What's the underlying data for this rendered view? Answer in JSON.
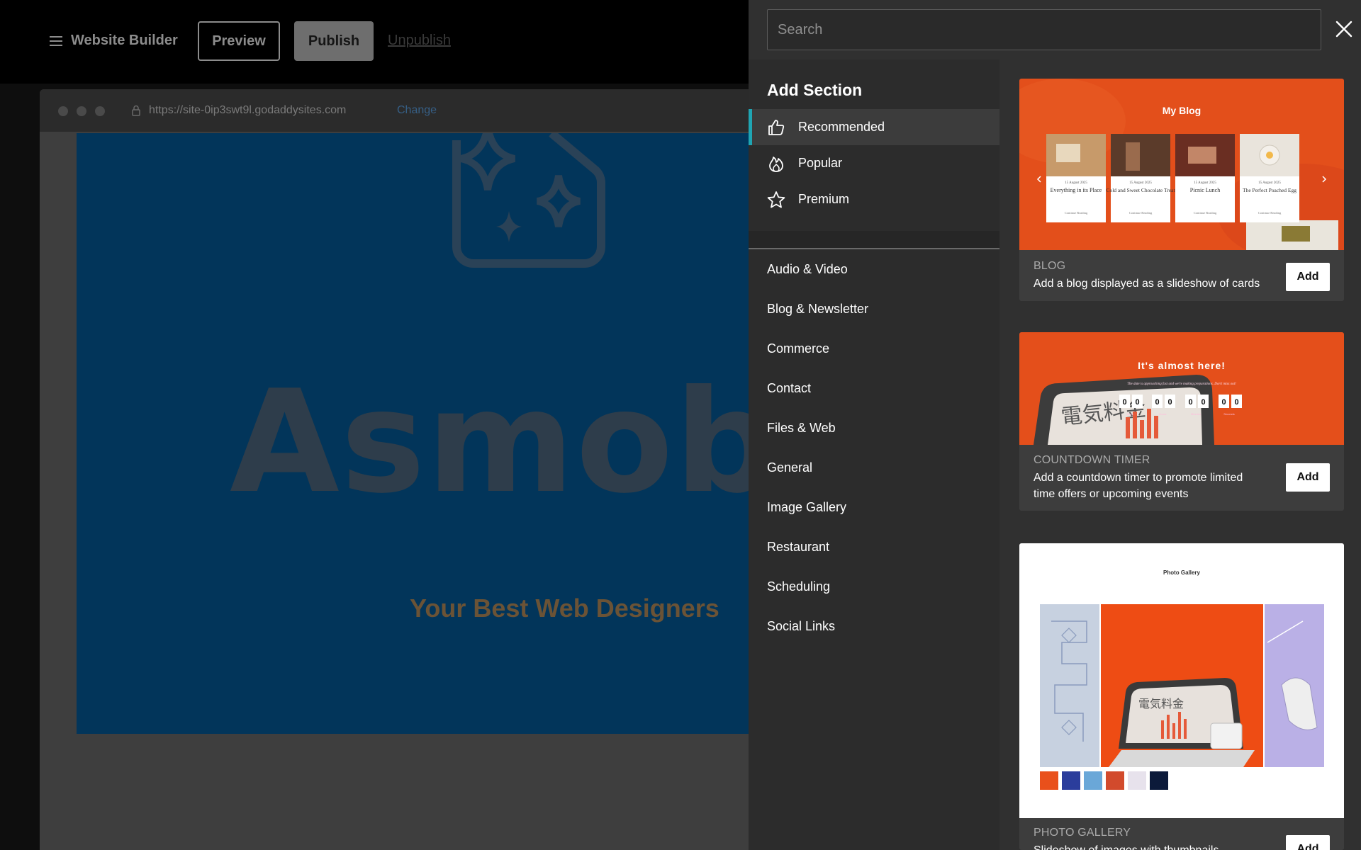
{
  "editor": {
    "menu_label": "Website Builder",
    "preview_label": "Preview",
    "publish_label": "Publish",
    "unpublish_label": "Unpublish",
    "url": "https://site-0ip3swt9l.godaddysites.com",
    "change_label": "Change",
    "site_title": "Asmobbi",
    "site_subtitle": "Your Best Web Designers"
  },
  "panel": {
    "search_placeholder": "Search",
    "title": "Add Section",
    "featured": [
      {
        "label": "Recommended",
        "icon": "thumbs-up-icon",
        "active": true
      },
      {
        "label": "Popular",
        "icon": "flame-icon",
        "active": false
      },
      {
        "label": "Premium",
        "icon": "star-icon",
        "active": false
      }
    ],
    "categories": [
      "Audio & Video",
      "Blog & Newsletter",
      "Commerce",
      "Contact",
      "Files & Web",
      "General",
      "Image Gallery",
      "Restaurant",
      "Scheduling",
      "Social Links"
    ],
    "cards": [
      {
        "kind": "BLOG",
        "description": "Add a blog displayed as a slideshow of cards",
        "add_label": "Add",
        "preview": {
          "heading": "My Blog",
          "posts": [
            {
              "date": "15 August 2025",
              "title": "Everything in its Place",
              "cta": "Continue Reading"
            },
            {
              "date": "15 August 2025",
              "title": "Cold and Sweet Chocolate Treat",
              "cta": "Continue Reading"
            },
            {
              "date": "15 August 2025",
              "title": "Picnic Lunch",
              "cta": "Continue Reading"
            },
            {
              "date": "15 August 2025",
              "title": "The Perfect Poached Egg",
              "cta": "Continue Reading"
            }
          ]
        }
      },
      {
        "kind": "COUNTDOWN TIMER",
        "description": "Add a countdown timer to promote limited time offers or upcoming events",
        "add_label": "Add",
        "preview": {
          "heading": "It's almost here!",
          "subheading": "The date is approaching fast and we're making preparations. Don't miss out!",
          "digits": [
            "0",
            "0",
            "0",
            "0",
            "0",
            "0",
            "0",
            "0"
          ],
          "unit_labels": [
            "Days",
            "Hours",
            "Minutes",
            "Seconds"
          ],
          "screen_text": "電気料金"
        }
      },
      {
        "kind": "PHOTO GALLERY",
        "description": "Slideshow of images with thumbnails",
        "add_label": "Add",
        "preview": {
          "heading": "Photo Gallery",
          "screen_text": "電気料金",
          "thumb_colors": [
            "#e9501b",
            "#2b3d9c",
            "#6aa7d8",
            "#d24a2c",
            "#e7e2ec",
            "#0c1a3a"
          ]
        }
      }
    ]
  },
  "colors": {
    "accent": "#1fa5b3",
    "orange": "#e8501c",
    "panel_bg": "#303030"
  }
}
